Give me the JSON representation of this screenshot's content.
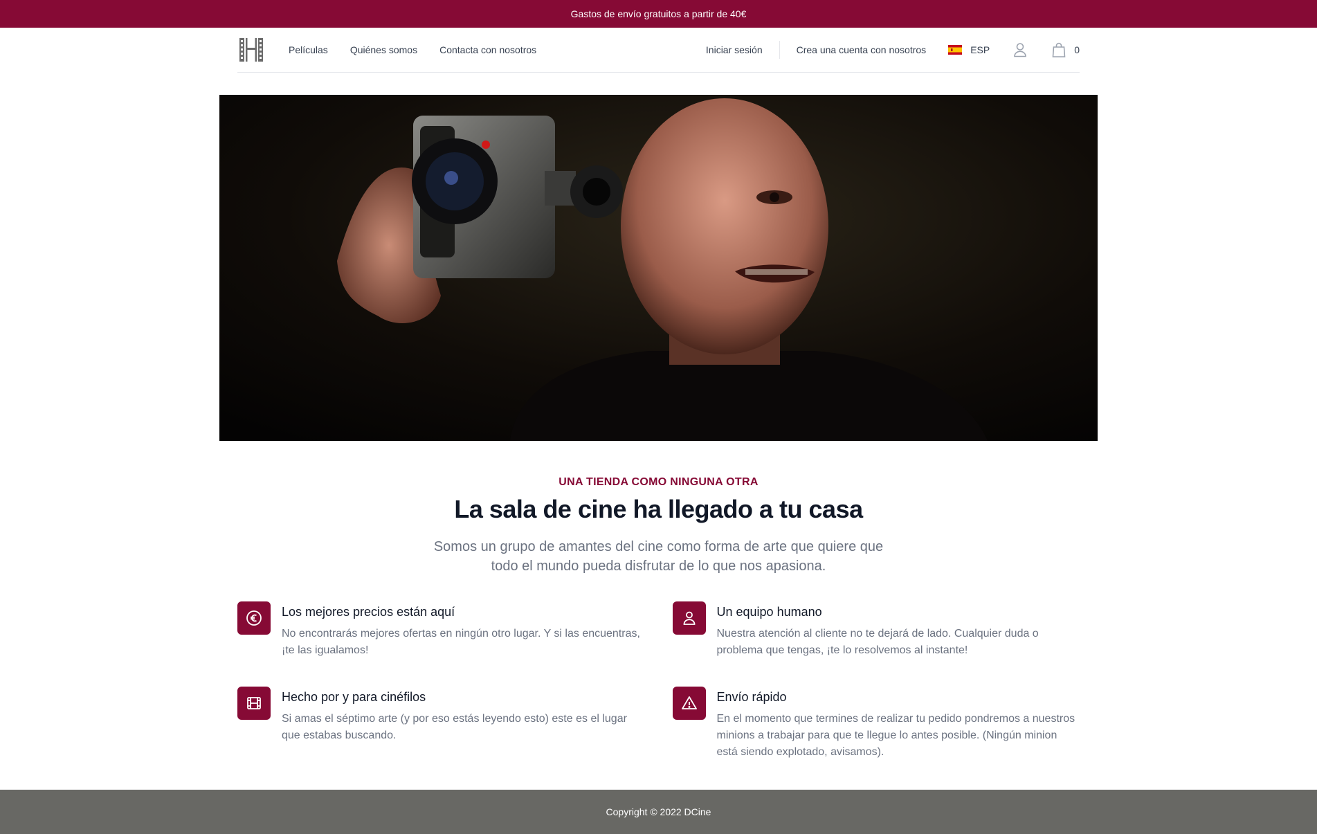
{
  "promo": {
    "text": "Gastos de envío gratuitos a partir de 40€"
  },
  "header": {
    "logo_icon": "film-strip-logo-icon",
    "nav": [
      "Películas",
      "Quiénes somos",
      "Contacta con nosotros"
    ],
    "login_label": "Iniciar sesión",
    "register_label": "Crea una cuenta con nosotros",
    "language": {
      "flag": "spain-flag-icon",
      "code": "ESP"
    },
    "user_icon": "user-icon",
    "cart": {
      "icon": "shopping-bag-icon",
      "count": "0"
    }
  },
  "hero": {
    "image": "man-holding-film-camera-to-eye"
  },
  "intro": {
    "eyebrow": "UNA TIENDA COMO NINGUNA OTRA",
    "headline": "La sala de cine ha llegado a tu casa",
    "lead": "Somos un grupo de amantes del cine como forma de arte que quiere que todo el mundo pueda disfrutar de lo que nos apasiona."
  },
  "features": [
    {
      "icon": "euro-icon",
      "title": "Los mejores precios están aquí",
      "description": "No encontrarás mejores ofertas en ningún otro lugar. Y si las encuentras, ¡te las igualamos!"
    },
    {
      "icon": "user-icon",
      "title": "Un equipo humano",
      "description": "Nuestra atención al cliente no te dejará de lado. Cualquier duda o problema que tengas, ¡te lo resolvemos al instante!"
    },
    {
      "icon": "film-icon",
      "title": "Hecho por y para cinéfilos",
      "description": "Si amas el séptimo arte (y por eso estás leyendo esto) este es el lugar que estabas buscando."
    },
    {
      "icon": "warning-triangle-icon",
      "title": "Envío rápido",
      "description": "En el momento que termines de realizar tu pedido pondremos a nuestros minions a trabajar para que te llegue lo antes posible. (Ningún minion está siendo explotado, avisamos)."
    }
  ],
  "footer": {
    "copyright": "Copyright © 2022 DCine"
  },
  "colors": {
    "brand": "#860a35",
    "footer": "#686864",
    "text": "#111827",
    "muted": "#6b7280"
  }
}
